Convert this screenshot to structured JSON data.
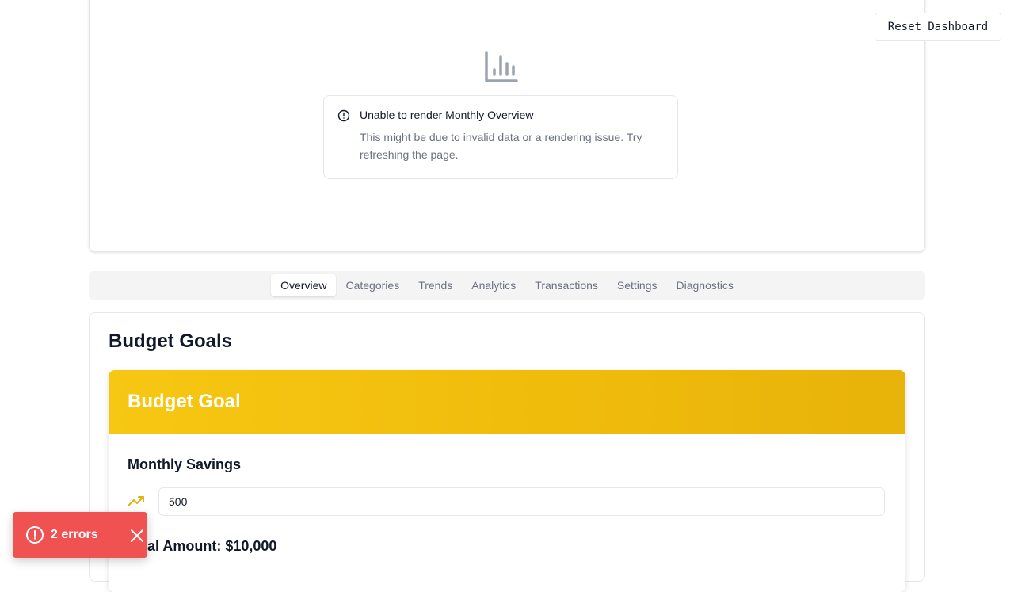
{
  "header": {
    "reset_label": "Reset Dashboard"
  },
  "chart_error": {
    "title": "Unable to render Monthly Overview",
    "description": "This might be due to invalid data or a rendering issue. Try refreshing the page."
  },
  "tabs": [
    {
      "label": "Overview",
      "active": true
    },
    {
      "label": "Categories"
    },
    {
      "label": "Trends"
    },
    {
      "label": "Analytics"
    },
    {
      "label": "Transactions"
    },
    {
      "label": "Settings"
    },
    {
      "label": "Diagnostics"
    }
  ],
  "budget_goals": {
    "section_title": "Budget Goals",
    "card_title": "Budget Goal",
    "goal_name": "Monthly Savings",
    "input_value": "500",
    "goal_amount": "Goal Amount: $10,000"
  },
  "toast": {
    "text": "2 errors"
  },
  "colors": {
    "accent": "#f1bd0c",
    "error": "#f05252",
    "muted_icon": "#9ca3af"
  },
  "icons": {
    "chart": "bar-chart-icon",
    "alert": "alert-circle-icon",
    "trend": "trending-up-icon",
    "close": "close-icon"
  }
}
